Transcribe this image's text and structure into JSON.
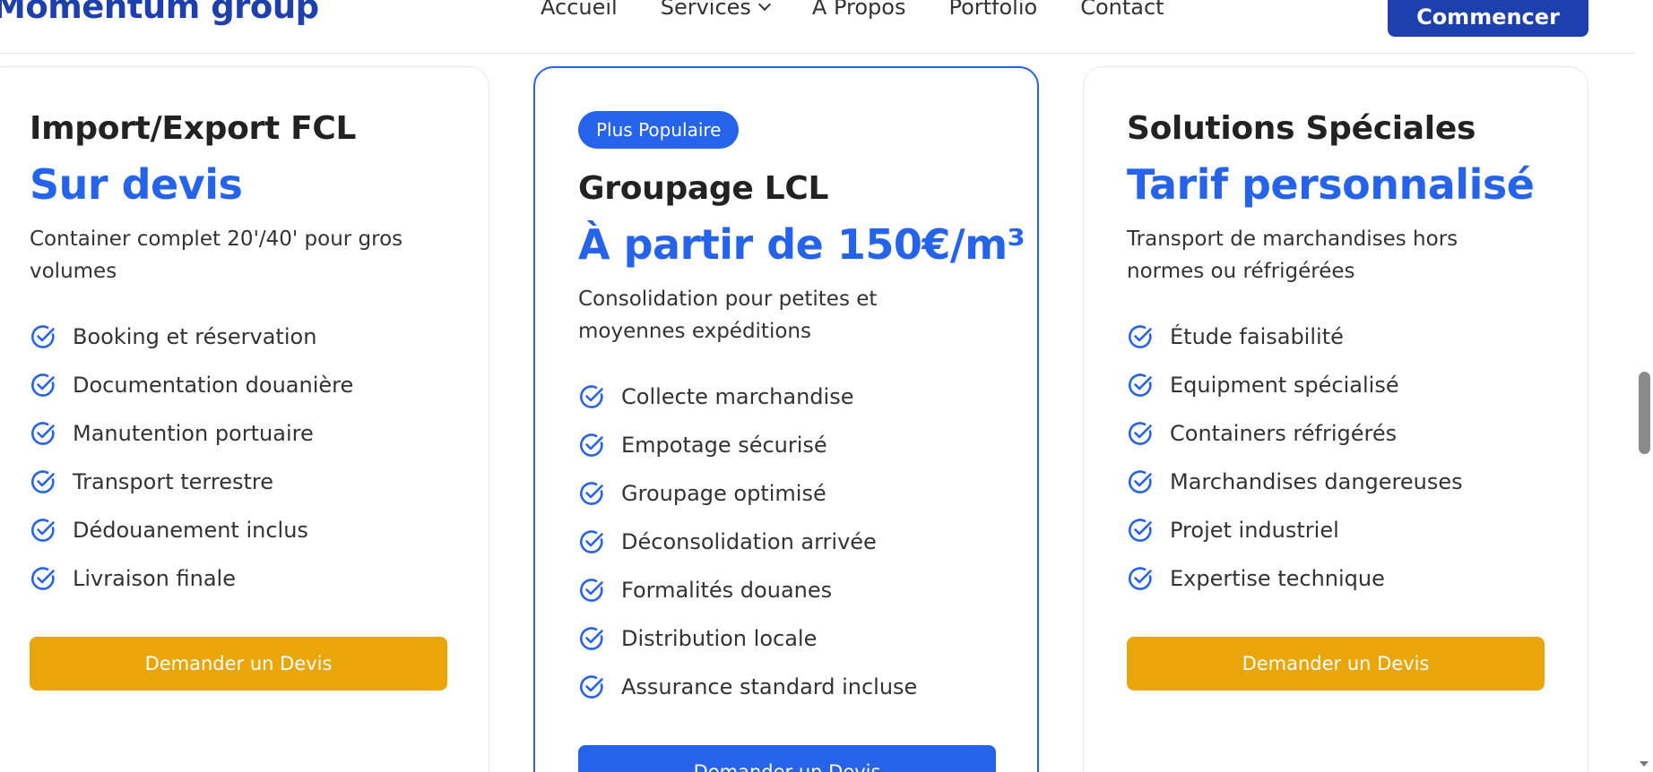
{
  "header": {
    "logo": "Momentum group",
    "nav": [
      {
        "label": "Accueil"
      },
      {
        "label": "Services",
        "has_dropdown": true
      },
      {
        "label": "A Propos"
      },
      {
        "label": "Portfolio"
      },
      {
        "label": "Contact"
      }
    ],
    "cta_label": "Commencer"
  },
  "colors": {
    "primary": "#2563eb",
    "dark_blue": "#1e40af",
    "amber": "#eaa608"
  },
  "cards": [
    {
      "title": "Import/Export FCL",
      "price": "Sur devis",
      "description": "Container complet 20'/40' pour gros volumes",
      "features": [
        "Booking et réservation",
        "Documentation douanière",
        "Manutention portuaire",
        "Transport terrestre",
        "Dédouanement inclus",
        "Livraison finale"
      ],
      "button_label": "Demander un Devis"
    },
    {
      "badge": "Plus Populaire",
      "title": "Groupage LCL",
      "price": "À partir de 150€/m³",
      "description": "Consolidation pour petites et moyennes expéditions",
      "features": [
        "Collecte marchandise",
        "Empotage sécurisé",
        "Groupage optimisé",
        "Déconsolidation arrivée",
        "Formalités douanes",
        "Distribution locale",
        "Assurance standard incluse"
      ],
      "button_label": "Demander un Devis"
    },
    {
      "title": "Solutions Spéciales",
      "price": "Tarif personnalisé",
      "description": "Transport de marchandises hors normes ou réfrigérées",
      "features": [
        "Étude faisabilité",
        "Equipment spécialisé",
        "Containers réfrigérés",
        "Marchandises dangereuses",
        "Projet industriel",
        "Expertise technique"
      ],
      "button_label": "Demander un Devis"
    }
  ]
}
